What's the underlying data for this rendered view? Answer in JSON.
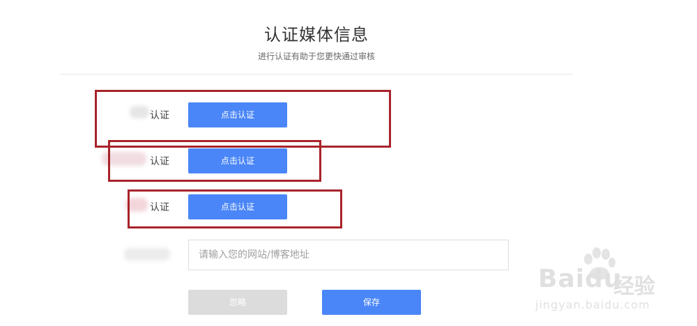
{
  "header": {
    "title": "认证媒体信息",
    "subtitle": "进行认证有助于您更快通过审核"
  },
  "rows": [
    {
      "label": "认证",
      "button_label": "点击认证"
    },
    {
      "label": "认证",
      "button_label": "点击认证"
    },
    {
      "label": "认证",
      "button_label": "点击认证"
    }
  ],
  "website": {
    "placeholder": "请输入您的网站/博客地址",
    "value": ""
  },
  "actions": {
    "skip_label": "忽略",
    "save_label": "保存"
  },
  "watermark": {
    "brand": "Baidu",
    "brand_cn": "经验",
    "domain": "jingyan.baidu.com"
  },
  "colors": {
    "primary": "#4a86f7",
    "disabled": "#dcdcdc",
    "highlight_box": "#a8232a"
  }
}
